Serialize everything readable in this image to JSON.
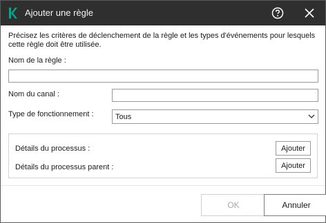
{
  "window": {
    "title": "Ajouter une règle",
    "logo_icon": "kaspersky-k-logo",
    "accent_color": "#00a88e",
    "titlebar_color": "#2f2f2f"
  },
  "description": "Précisez les critères de déclenchement de la règle et les types d'événements pour lesquels cette règle doit être utilisée.",
  "form": {
    "rule_name": {
      "label": "Nom de la règle :",
      "value": ""
    },
    "channel_name": {
      "label": "Nom du canal :",
      "value": ""
    },
    "operation_type": {
      "label": "Type de fonctionnement :",
      "selected": "Tous"
    }
  },
  "process_group": {
    "process_details": {
      "label": "Détails du processus :",
      "button": "Ajouter"
    },
    "parent_process_details": {
      "label": "Détails du processus parent :",
      "button": "Ajouter"
    }
  },
  "footer": {
    "ok_label": "OK",
    "ok_disabled": true,
    "cancel_label": "Annuler"
  }
}
